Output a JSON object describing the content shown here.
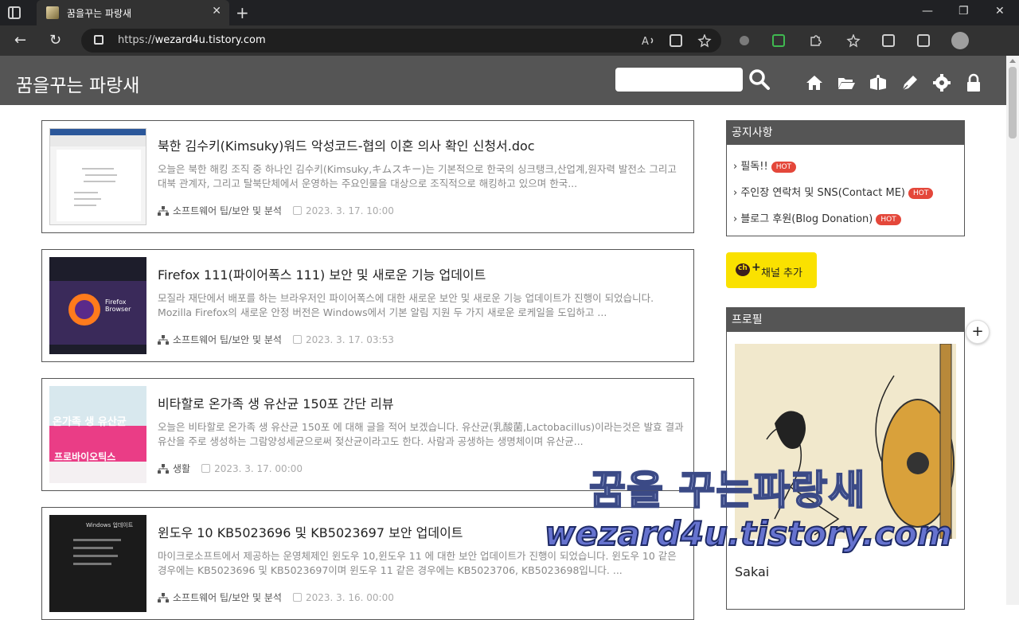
{
  "browser": {
    "tab_title": "꿈을꾸는 파랑새",
    "url_prefix": "https://",
    "url_host": "wezard4u.tistory.com",
    "new_tab": "+",
    "close_tab": "✕",
    "minimize": "—",
    "maximize": "❐",
    "close_window": "✕",
    "back": "←",
    "refresh": "↻",
    "more": "···"
  },
  "site": {
    "title": "꿈을꾸는 파랑새",
    "search_placeholder": "",
    "nav_icons": [
      "home-icon",
      "folder-icon",
      "guestbook-icon",
      "write-icon",
      "settings-icon",
      "lock-icon"
    ]
  },
  "posts": [
    {
      "title": "북한 김수키(Kimsuky)워드 악성코드-협의 이혼 의사 확인 신청서.doc",
      "excerpt": "오늘은 북한 해킹 조직 중 하나인 김수키(Kimsuky,キムスキー)는 기본적으로 한국의 싱크탱크,산업계,원자력 발전소 그리고 대북 관계자, 그리고 탈북단체에서 운영하는 주요인물을 대상으로 조직적으로 해킹하고 있으며 한국...",
      "category": "소프트웨어 팁/보안 및 분석",
      "date": "2023. 3. 17. 10:00"
    },
    {
      "title": "Firefox 111(파이어폭스 111) 보안 및 새로운 기능 업데이트",
      "excerpt": "모질라 재단에서 배포를 하는 브라우저인 파이어폭스에 대한 새로운 보안 및 새로운 기능 업데이트가 진행이 되었습니다. Mozilla Firefox의 새로운 안정 버전은 Windows에서 기본 알림 지원 두 가지 새로운 로케일을 도입하고 ...",
      "category": "소프트웨어 팁/보안 및 분석",
      "date": "2023. 3. 17. 03:53",
      "thumb_text": "Firefox Browser"
    },
    {
      "title": "비타할로 온가족 생 유산균 150포 간단 리뷰",
      "excerpt": "오늘은 비타할로 온가족 생 유산균 150포 에 대해 글을 적어 보겠습니다. 유산균(乳酸菌,Lactobacillus)이라는것은 발효 결과 유산을 주로 생성하는 그람양성세균으로써 젖산균이라고도 한다. 사람과 공생하는 생명체이며 유산균...",
      "category": "생활",
      "date": "2023. 3. 17. 00:00",
      "thumb_text": "온가족 생 유산균",
      "thumb_sub": "프로바이오틱스"
    },
    {
      "title": "윈도우 10 KB5023696 및 KB5023697 보안 업데이트",
      "excerpt": "마이크로소프트에서 제공하는 운영체제인 윈도우 10,윈도우 11 에 대한 보안 업데이트가 진행이 되었습니다. 윈도우 10 같은 경우에는 KB5023696 및 KB5023697이며 윈도우 11 같은 경우에는 KB5023706, KB5023698입니다. ...",
      "category": "소프트웨어 팁/보안 및 분석",
      "date": "2023. 3. 16. 00:00",
      "thumb_text": "Windows 업데이트"
    }
  ],
  "sidebar": {
    "notice_title": "공지사항",
    "notices": [
      {
        "label": "필독!!",
        "badge": "HOT"
      },
      {
        "label": "주인장 연락처 및 SNS(Contact ME)",
        "badge": "HOT"
      },
      {
        "label": "블로그 후원(Blog Donation)",
        "badge": "HOT"
      }
    ],
    "channel_button": "채널 추가",
    "channel_icon_text": "ch",
    "profile_title": "프로필",
    "profile_name": "Sakai"
  },
  "watermark": {
    "line1": "꿈을 꾸는파랑새",
    "line2": "wezard4u.tistory.com"
  },
  "colors": {
    "header_bg": "#555555",
    "hot_badge": "#e4473a",
    "channel_bg": "#fae100"
  }
}
